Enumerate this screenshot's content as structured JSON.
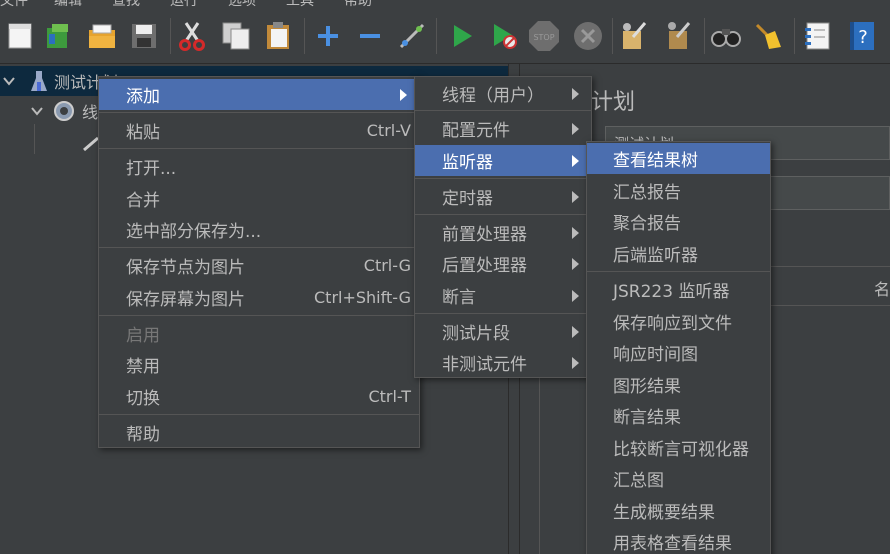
{
  "menubar": [
    "文件",
    "编辑",
    "查找",
    "运行",
    "选项",
    "工具",
    "帮助"
  ],
  "tree": {
    "root_label": "测试计划",
    "child_label": "线"
  },
  "right": {
    "title": "计划",
    "name_value": "测试计划"
  },
  "right_col_header": "名",
  "context_menu": {
    "items": [
      {
        "label": "添加",
        "shortcut": "",
        "submenu": true,
        "highlighted": true
      },
      {
        "label": "粘贴",
        "shortcut": "Ctrl-V"
      },
      {
        "label": "打开...",
        "shortcut": ""
      },
      {
        "label": "合并",
        "shortcut": ""
      },
      {
        "label": "选中部分保存为...",
        "shortcut": ""
      },
      {
        "label": "保存节点为图片",
        "shortcut": "Ctrl-G"
      },
      {
        "label": "保存屏幕为图片",
        "shortcut": "Ctrl+Shift-G"
      },
      {
        "label": "启用",
        "shortcut": "",
        "disabled": true
      },
      {
        "label": "禁用",
        "shortcut": ""
      },
      {
        "label": "切换",
        "shortcut": "Ctrl-T"
      },
      {
        "label": "帮助",
        "shortcut": ""
      }
    ]
  },
  "add_submenu": {
    "items": [
      {
        "label": "线程（用户）"
      },
      {
        "label": "配置元件"
      },
      {
        "label": "监听器",
        "highlighted": true
      },
      {
        "label": "定时器"
      },
      {
        "label": "前置处理器"
      },
      {
        "label": "后置处理器"
      },
      {
        "label": "断言"
      },
      {
        "label": "测试片段"
      },
      {
        "label": "非测试元件"
      }
    ]
  },
  "listener_submenu": {
    "items": [
      {
        "label": "查看结果树",
        "highlighted": true
      },
      {
        "label": "汇总报告"
      },
      {
        "label": "聚合报告"
      },
      {
        "label": "后端监听器"
      },
      {
        "label": "JSR223 监听器"
      },
      {
        "label": "保存响应到文件"
      },
      {
        "label": "响应时间图"
      },
      {
        "label": "图形结果"
      },
      {
        "label": "断言结果"
      },
      {
        "label": "比较断言可视化器"
      },
      {
        "label": "汇总图"
      },
      {
        "label": "生成概要结果"
      },
      {
        "label": "用表格查看结果"
      }
    ]
  },
  "colors": {
    "background": "#3c3f41",
    "highlight": "#4b6eaf",
    "text": "#bbbbbb"
  }
}
